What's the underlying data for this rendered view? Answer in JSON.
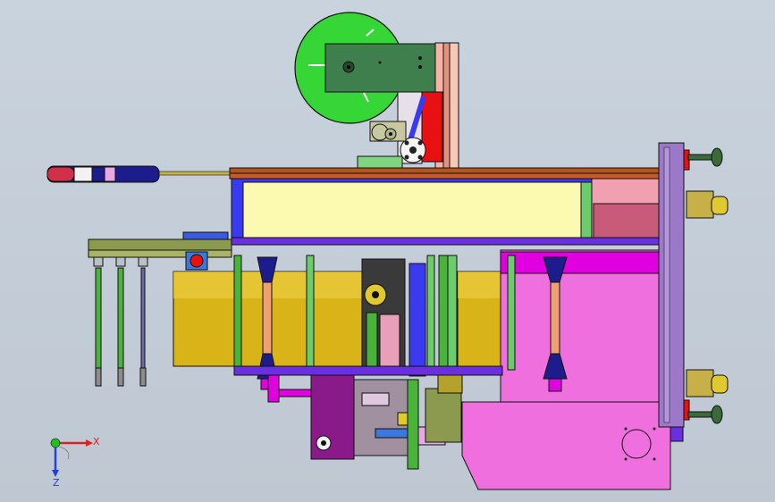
{
  "viewport": {
    "background": "#c4ced8",
    "palette": {
      "green_disk": "#35d635",
      "dark_green_plate": "#3f7f4e",
      "salmon": "#f0a08c",
      "red": "#e81010",
      "blue_rail": "#3a3af0",
      "cream_panel": "#fbfab0",
      "gold_roll": "#d8b418",
      "pink_base": "#f06fde",
      "magenta": "#e000e0",
      "navy": "#1c1c8c",
      "brown_rod": "#b4541e",
      "violet_frame": "#9c78c8",
      "olive": "#8c9a50",
      "khaki": "#b4a22c"
    }
  },
  "axis_triad": {
    "x_label": "X",
    "z_label": "Z",
    "x_color": "#e02020",
    "z_color": "#2040e0",
    "origin_color": "#20c020"
  }
}
